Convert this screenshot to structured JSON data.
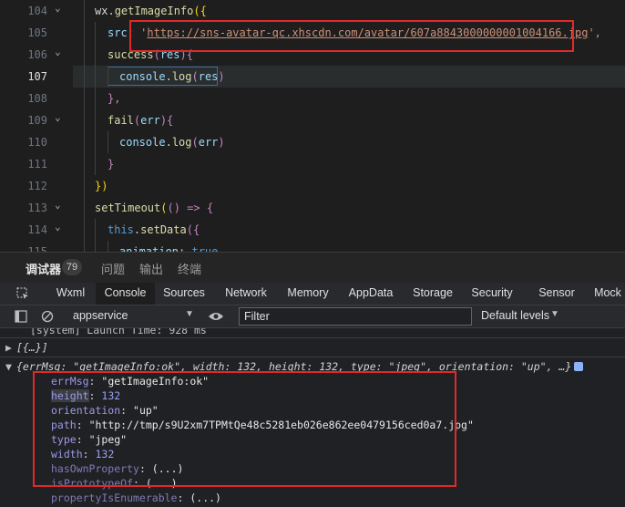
{
  "editor": {
    "lines": [
      {
        "num": "104",
        "code_parts": [
          {
            "t": "wx.",
            "c": "white"
          },
          {
            "t": "getImageInfo",
            "c": "yellow"
          },
          {
            "t": "({",
            "c": "gold"
          }
        ]
      },
      {
        "num": "105",
        "code_parts": [
          {
            "t": "src",
            "c": "blue"
          },
          {
            "t": ": ",
            "c": "white"
          },
          {
            "t": "'",
            "c": "orange"
          },
          {
            "t": "https://sns-avatar-qc.xhscdn.com/avatar/607a8843000000001004166.jpg",
            "c": "url"
          },
          {
            "t": "',",
            "c": "orange"
          }
        ]
      },
      {
        "num": "106",
        "code_parts": [
          {
            "t": "success",
            "c": "yellow"
          },
          {
            "t": "(",
            "c": "purple"
          },
          {
            "t": "res",
            "c": "blue"
          },
          {
            "t": "){",
            "c": "purple"
          }
        ]
      },
      {
        "num": "107",
        "code_parts": [
          {
            "t": "console",
            "c": "blue"
          },
          {
            "t": ".",
            "c": "white"
          },
          {
            "t": "log",
            "c": "yellow"
          },
          {
            "t": "(",
            "c": "purple"
          },
          {
            "t": "res",
            "c": "blue"
          },
          {
            "t": ")",
            "c": "purple"
          }
        ]
      },
      {
        "num": "108",
        "code_parts": [
          {
            "t": "},",
            "c": "purple"
          }
        ]
      },
      {
        "num": "109",
        "code_parts": [
          {
            "t": "fail",
            "c": "yellow"
          },
          {
            "t": "(",
            "c": "purple"
          },
          {
            "t": "err",
            "c": "blue"
          },
          {
            "t": "){",
            "c": "purple"
          }
        ]
      },
      {
        "num": "110",
        "code_parts": [
          {
            "t": "console",
            "c": "blue"
          },
          {
            "t": ".",
            "c": "white"
          },
          {
            "t": "log",
            "c": "yellow"
          },
          {
            "t": "(",
            "c": "purple"
          },
          {
            "t": "err",
            "c": "blue"
          },
          {
            "t": ")",
            "c": "purple"
          }
        ]
      },
      {
        "num": "111",
        "code_parts": [
          {
            "t": "}",
            "c": "purple"
          }
        ]
      },
      {
        "num": "112",
        "code_parts": [
          {
            "t": "})",
            "c": "gold"
          }
        ]
      },
      {
        "num": "113",
        "code_parts": [
          {
            "t": "setTimeout",
            "c": "yellow"
          },
          {
            "t": "(",
            "c": "gold"
          },
          {
            "t": "() => {",
            "c": "purple"
          }
        ]
      },
      {
        "num": "114",
        "code_parts": [
          {
            "t": "this",
            "c": "kw"
          },
          {
            "t": ".",
            "c": "white"
          },
          {
            "t": "setData",
            "c": "yellow"
          },
          {
            "t": "({",
            "c": "purple"
          }
        ]
      },
      {
        "num": "115",
        "code_parts": [
          {
            "t": "animation",
            "c": "blue"
          },
          {
            "t": ": ",
            "c": "white"
          },
          {
            "t": "true",
            "c": "kw"
          }
        ]
      }
    ]
  },
  "bottom_tabs": {
    "debugger": "调试器",
    "count": "79",
    "issues": "问题",
    "output": "输出",
    "terminal": "终端"
  },
  "devtools_tabs": [
    "Wxml",
    "Console",
    "Sources",
    "Network",
    "Memory",
    "AppData",
    "Storage",
    "Security",
    "Sensor",
    "Mock"
  ],
  "console_bar": {
    "context": "appservice",
    "filter_placeholder": "Filter",
    "levels": "Default levels"
  },
  "console": {
    "launch_line": "[system] Launch Time: 928 ms",
    "collapsed": "[{…}]",
    "object_summary": "{errMsg: \"getImageInfo:ok\", width: 132, height: 132, type: \"jpeg\", orientation: \"up\", …}",
    "props": [
      {
        "key": "errMsg",
        "value": "\"getImageInfo:ok\""
      },
      {
        "key": "height",
        "value": "132"
      },
      {
        "key": "orientation",
        "value": "\"up\""
      },
      {
        "key": "path",
        "value": "\"http://tmp/s9U2xm7TPMtQe48c5281eb026e862ee0479156ced0a7.jpg\""
      },
      {
        "key": "type",
        "value": "\"jpeg\""
      },
      {
        "key": "width",
        "value": "132"
      },
      {
        "key": "hasOwnProperty",
        "value": "(...)"
      },
      {
        "key": "isPrototypeOf",
        "value": "(...)"
      },
      {
        "key": "propertyIsEnumerable",
        "value": "(...)"
      }
    ]
  },
  "colors": {
    "highlight_box": "#e02a2a",
    "editor_bg": "#1e1e1e",
    "console_bg": "#202124"
  }
}
